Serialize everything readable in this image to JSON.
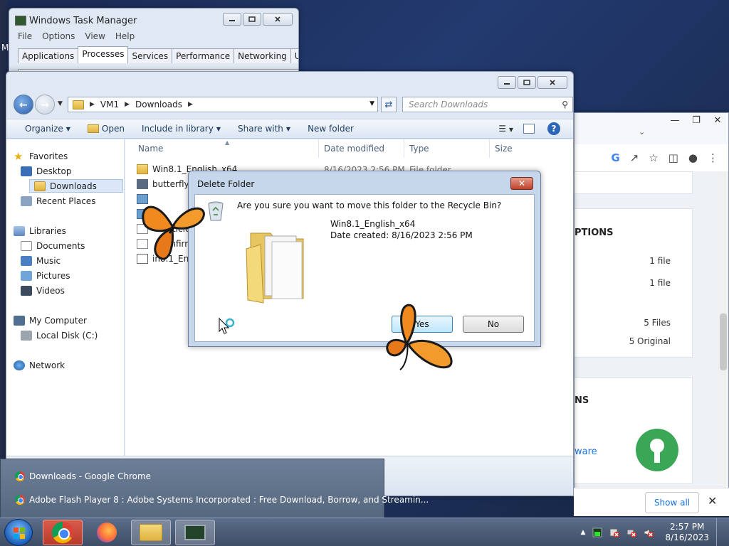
{
  "desktop": {
    "partial_letter": "M"
  },
  "taskmgr": {
    "title": "Windows Task Manager",
    "menu": [
      "File",
      "Options",
      "View",
      "Help"
    ],
    "tabs": [
      "Applications",
      "Processes",
      "Services",
      "Performance",
      "Networking",
      "Users"
    ],
    "active_tab": "Processes"
  },
  "explorer": {
    "breadcrumbs": [
      "VM1",
      "Downloads"
    ],
    "search_placeholder": "Search Downloads",
    "commands": {
      "organize": "Organize",
      "open": "Open",
      "include_in_library": "Include in library",
      "share_with": "Share with",
      "new_folder": "New folder"
    },
    "nav": {
      "favorites": "Favorites",
      "desktop": "Desktop",
      "downloads": "Downloads",
      "recent_places": "Recent Places",
      "libraries": "Libraries",
      "documents": "Documents",
      "music": "Music",
      "pictures": "Pictures",
      "videos": "Videos",
      "my_computer": "My Computer",
      "local_disk": "Local Disk (C:)",
      "network": "Network"
    },
    "columns": {
      "name": "Name",
      "date_modified": "Date modified",
      "type": "Type",
      "size": "Size"
    },
    "files": [
      {
        "name": "Win8.1_English_x64",
        "date": "8/16/2023 2:56 PM",
        "type": "File folder",
        "icon": "folder"
      },
      {
        "name": "butterflyc",
        "date": "",
        "type": "",
        "icon": "exe"
      },
      {
        "name": "",
        "date": "",
        "type": "",
        "icon": "image"
      },
      {
        "name": "",
        "date": "",
        "type": "",
        "icon": "image"
      },
      {
        "name": "ticles",
        "date": "",
        "type": "",
        "icon": "txt"
      },
      {
        "name": "onfirm",
        "date": "",
        "type": "",
        "icon": "txt"
      },
      {
        "name": "in8.1_En",
        "date": "",
        "type": "",
        "icon": "iso"
      }
    ]
  },
  "dialog": {
    "title": "Delete Folder",
    "close_label": "✕",
    "question": "Are you sure you want to move this folder to the Recycle Bin?",
    "file_name": "Win8.1_English_x64",
    "file_date": "Date created: 8/16/2023 2:56 PM",
    "yes_label": "Yes",
    "no_label": "No"
  },
  "chrome": {
    "heading_options": "PTIONS",
    "row1_value": "1 file",
    "row2_value": "1 file",
    "row3_value": "5 Files",
    "row4_value": "5 Original",
    "heading_ns": "NS",
    "link_text": "ware",
    "show_all_label": "Show all",
    "close_label": "✕"
  },
  "taskbar_preview": {
    "items": [
      "Downloads - Google Chrome",
      "Adobe Flash Player 8 : Adobe Systems Incorporated : Free Download, Borrow, and Streamin..."
    ]
  },
  "tray": {
    "time": "2:57 PM",
    "date": "8/16/2023"
  },
  "colors": {
    "accent": "#1a73e8",
    "dialog_close": "#c2402a",
    "lock_badge": "#3aa757"
  }
}
